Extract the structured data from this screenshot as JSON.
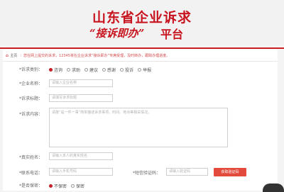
{
  "banner": {
    "title": "山东省企业诉求",
    "slogan": "“接诉即办”",
    "platform": "平台"
  },
  "breadcrumb": {
    "home": "主页",
    "notice": "：您在网上提交的诉求，12345将在企业诉求“接诉即办”专席受理，及时转办，跟踪办理进度。"
  },
  "form": {
    "type_label": "*诉求类别：",
    "type_options": [
      {
        "label": "咨询",
        "checked": true
      },
      {
        "label": "求助",
        "checked": false
      },
      {
        "label": "建议",
        "checked": false
      },
      {
        "label": "感谢",
        "checked": false
      },
      {
        "label": "投诉",
        "checked": false
      },
      {
        "label": "举报",
        "checked": false
      }
    ],
    "company_label": "*企业名称：",
    "company_placeholder": "请输入企业名称",
    "subject_label": "*诉求标题：",
    "subject_placeholder": "请填写诉求标题",
    "content_label": "*诉求内容：",
    "content_placeholder": "请按“是一件一事”简单描述诉求事项、时间、地点等相关情况。",
    "name_label": "*真实姓名：",
    "name_placeholder": "请输入本人的真实姓名",
    "phone_label": "*联系电话：",
    "phone_placeholder": "请输入手机号码",
    "code_label": "*短信验证码：",
    "code_placeholder": "请输入验证码",
    "code_button": "获取验证码",
    "privacy_label": "*是否保密：",
    "privacy_options": [
      {
        "label": "不保密",
        "checked": true
      },
      {
        "label": "保密",
        "checked": false
      }
    ]
  },
  "colors": {
    "brand_red": "#c8141e",
    "button_red": "#e24a3b"
  }
}
